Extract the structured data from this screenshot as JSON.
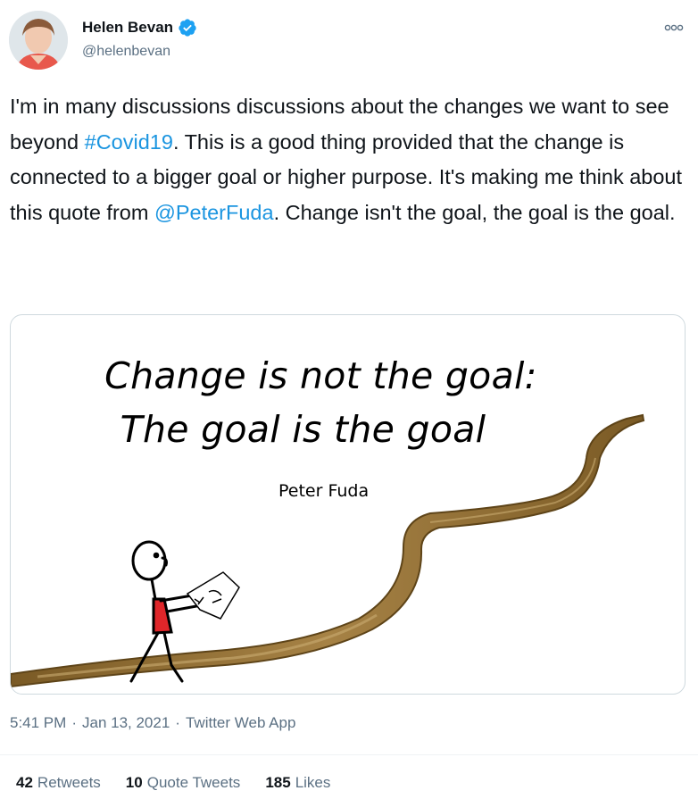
{
  "author": {
    "name": "Helen Bevan",
    "handle": "@helenbevan",
    "verified": true
  },
  "tweet": {
    "text_part1": "I'm in many discussions discussions about the changes we want to see beyond ",
    "hashtag": "#Covid19",
    "text_part2": ". This is a good thing provided that the change is connected to a bigger goal or higher purpose. It's making me think about this quote from ",
    "mention": "@PeterFuda",
    "text_part3": ". Change isn't the goal, the goal is the goal."
  },
  "media": {
    "quote_line1": "Change is not the goal:",
    "quote_line2": "The goal is the goal",
    "quote_author": "Peter Fuda"
  },
  "meta": {
    "time": "5:41 PM",
    "date": "Jan 13, 2021",
    "source": "Twitter Web App",
    "separator": "·"
  },
  "stats": {
    "retweets_count": "42",
    "retweets_label": "Retweets",
    "quotes_count": "10",
    "quotes_label": "Quote Tweets",
    "likes_count": "185",
    "likes_label": "Likes"
  },
  "colors": {
    "link": "#1b95e0",
    "muted": "#5b7083",
    "path": "#8a6a32"
  },
  "icons": {
    "verified": "verified-badge-icon",
    "more": "more-options-icon"
  }
}
